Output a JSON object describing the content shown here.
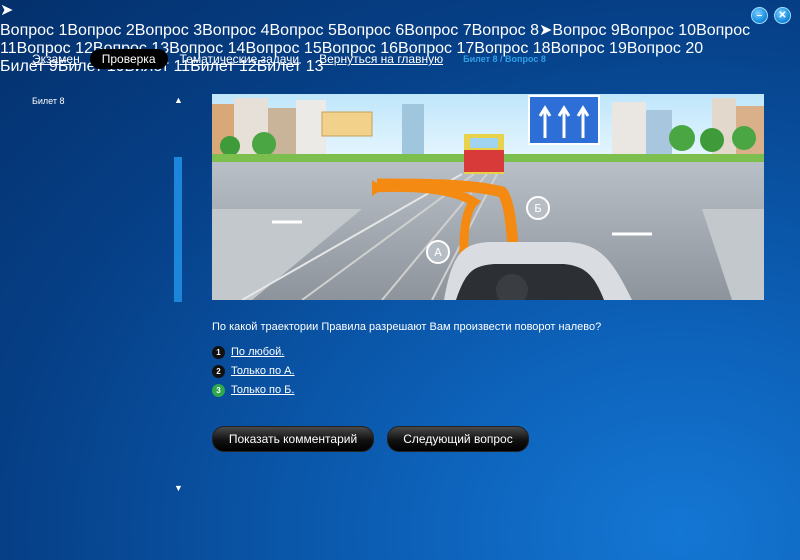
{
  "window": {
    "minimize_icon": "minimize-icon",
    "close_icon": "close-icon",
    "minimize": "–",
    "close": "✕"
  },
  "nav": {
    "exam": "Экзамен",
    "check": "Проверка",
    "thematic": "Тематические задачи",
    "home": "Вернуться на главную",
    "breadcrumb": "Билет 8 / Вопрос 8"
  },
  "tree": {
    "ticket_current": "Билет 8",
    "questions": [
      "Вопрос 1",
      "Вопрос 2",
      "Вопрос 3",
      "Вопрос 4",
      "Вопрос 5",
      "Вопрос 6",
      "Вопрос 7",
      "Вопрос 8",
      "Вопрос 9",
      "Вопрос 10",
      "Вопрос 11",
      "Вопрос 12",
      "Вопрос 13",
      "Вопрос 14",
      "Вопрос 15",
      "Вопрос 16",
      "Вопрос 17",
      "Вопрос 18",
      "Вопрос 19",
      "Вопрос 20"
    ],
    "active_question_index": 7,
    "tickets": [
      "Билет 9",
      "Билет 10",
      "Билет 11",
      "Билет 12",
      "Билет 13"
    ]
  },
  "scene": {
    "label_a": "А",
    "label_b": "Б"
  },
  "question": {
    "text": "По какой траектории Правила разрешают Вам произвести поворот налево?",
    "answers": [
      {
        "num": "1",
        "text": "По любой.",
        "correct": false
      },
      {
        "num": "2",
        "text": "Только по А.",
        "correct": false
      },
      {
        "num": "3",
        "text": "Только по Б.",
        "correct": true
      }
    ]
  },
  "buttons": {
    "comment": "Показать комментарий",
    "next": "Следующий вопрос"
  },
  "colors": {
    "accent": "#2ea0e8",
    "correct": "#2fa84b"
  }
}
